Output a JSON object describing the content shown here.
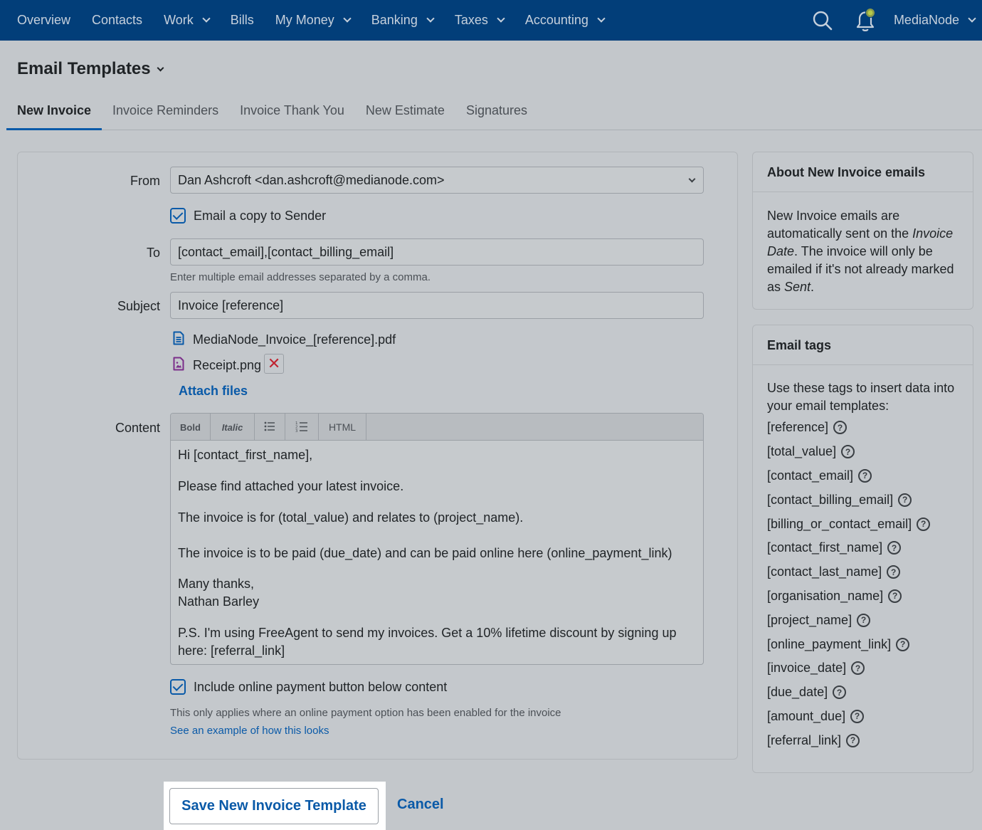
{
  "nav": {
    "items": [
      {
        "label": "Overview",
        "dropdown": false
      },
      {
        "label": "Contacts",
        "dropdown": false
      },
      {
        "label": "Work",
        "dropdown": true
      },
      {
        "label": "Bills",
        "dropdown": false
      },
      {
        "label": "My Money",
        "dropdown": true
      },
      {
        "label": "Banking",
        "dropdown": true
      },
      {
        "label": "Taxes",
        "dropdown": true
      },
      {
        "label": "Accounting",
        "dropdown": true
      }
    ],
    "account_label": "MediaNode",
    "icons": {
      "search": "search-icon",
      "notifications": "bell-icon"
    }
  },
  "page": {
    "title": "Email Templates",
    "tabs": [
      "New Invoice",
      "Invoice Reminders",
      "Invoice Thank You",
      "New Estimate",
      "Signatures"
    ],
    "active_tab": "New Invoice"
  },
  "form": {
    "from_label": "From",
    "from_value": "Dan Ashcroft <dan.ashcroft@medianode.com>",
    "copy_label": "Email a copy to Sender",
    "copy_checked": true,
    "to_label": "To",
    "to_value": "[contact_email],[contact_billing_email]",
    "to_hint": "Enter multiple email addresses separated by a comma.",
    "subject_label": "Subject",
    "subject_value": "Invoice [reference]",
    "attachments": [
      {
        "name": "MediaNode_Invoice_[reference].pdf",
        "icon": "document-icon",
        "removable": false
      },
      {
        "name": "Receipt.png",
        "icon": "image-file-icon",
        "removable": true
      }
    ],
    "remove_symbol": "✕",
    "attach_files_label": "Attach files",
    "content_label": "Content",
    "toolbar": {
      "bold": "Bold",
      "italic": "Italic",
      "html": "HTML"
    },
    "content": {
      "greeting": "Hi [contact_first_name],",
      "line1": "Please find attached your latest invoice.",
      "line2": "The invoice is for (total_value) and relates to (project_name).",
      "line3": "The invoice is to be paid (due_date) and can be paid online here (online_payment_link)",
      "signoff1": "Many thanks,",
      "signoff2": "Nathan Barley",
      "ps": "P.S. I'm using FreeAgent to send my invoices. Get a 10% lifetime discount by signing up here: [referral_link]"
    },
    "payment_button_label": "Include online payment button below content",
    "payment_button_checked": true,
    "payment_hint": "This only applies where an online payment option has been enabled for the invoice",
    "example_link": "See an example of how this looks"
  },
  "about": {
    "title": "About New Invoice emails",
    "text_before": "New Invoice emails are automatically sent on the ",
    "text_em1": "Invoice Date",
    "text_middle": ". The invoice will only be emailed if it's not already marked as ",
    "text_em2": "Sent",
    "text_end": "."
  },
  "tags": {
    "title": "Email tags",
    "intro": "Use these tags to insert data into your email templates:",
    "items": [
      "[reference]",
      "[total_value]",
      "[contact_email]",
      "[contact_billing_email]",
      "[billing_or_contact_email]",
      "[contact_first_name]",
      "[contact_last_name]",
      "[organisation_name]",
      "[project_name]",
      "[online_payment_link]",
      "[invoice_date]",
      "[due_date]",
      "[amount_due]",
      "[referral_link]"
    ],
    "help_symbol": "?"
  },
  "actions": {
    "save_label": "Save New Invoice Template",
    "cancel_label": "Cancel"
  },
  "colors": {
    "nav_bg": "#023e79",
    "accent": "#0a5aa8",
    "danger": "#c02431"
  }
}
